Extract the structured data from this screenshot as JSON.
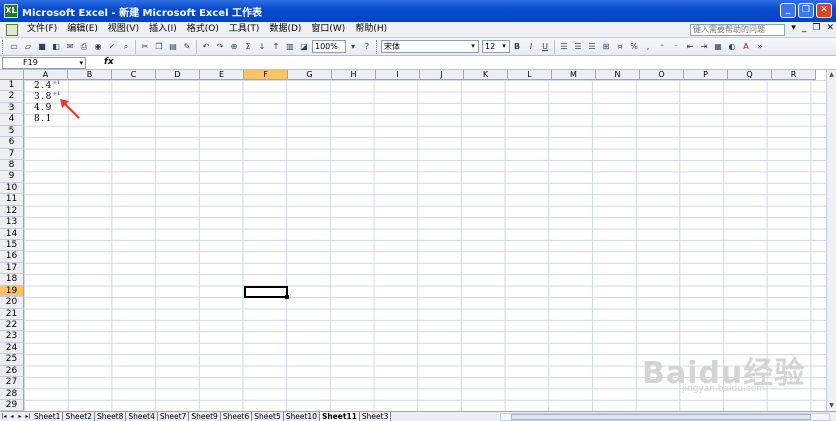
{
  "window": {
    "title": "Microsoft Excel - 新建 Microsoft Excel 工作表",
    "app_icon": "XL"
  },
  "menubar": {
    "items": [
      "文件(F)",
      "编辑(E)",
      "视图(V)",
      "插入(I)",
      "格式(O)",
      "工具(T)",
      "数据(D)",
      "窗口(W)",
      "帮助(H)"
    ],
    "help_placeholder": "键入需要帮助的问题"
  },
  "toolbar": {
    "zoom": "100%",
    "font": "宋体",
    "font_size": "12",
    "bold": "B",
    "italic": "I",
    "underline": "U"
  },
  "formula": {
    "name_box": "F19",
    "fx": "fx"
  },
  "columns": [
    "A",
    "B",
    "C",
    "D",
    "E",
    "F",
    "G",
    "H",
    "I",
    "J",
    "K",
    "L",
    "M",
    "N",
    "O",
    "P",
    "Q",
    "R"
  ],
  "active_column": "F",
  "rows": [
    "1",
    "2",
    "3",
    "4",
    "5",
    "6",
    "7",
    "8",
    "9",
    "10",
    "11",
    "12",
    "13",
    "14",
    "15",
    "16",
    "17",
    "18",
    "19",
    "20",
    "21",
    "22",
    "23",
    "24",
    "25",
    "26",
    "27",
    "28",
    "29"
  ],
  "active_row": "19",
  "cells": [
    {
      "row": 1,
      "col": "A",
      "value": "2.4",
      "sup": "+1"
    },
    {
      "row": 2,
      "col": "A",
      "value": "3.8",
      "sup": "+1"
    },
    {
      "row": 3,
      "col": "A",
      "value": "4.9",
      "sup": ""
    },
    {
      "row": 4,
      "col": "A",
      "value": "8.1",
      "sup": ""
    }
  ],
  "sheets": [
    "Sheet1",
    "Sheet2",
    "Sheet8",
    "Sheet4",
    "Sheet7",
    "Sheet9",
    "Sheet6",
    "Sheet5",
    "Sheet10",
    "Sheet11",
    "Sheet3"
  ],
  "active_sheet": "Sheet11",
  "colors": {
    "titlebar": "#0543c4",
    "active_header": "#f9c468",
    "arrow": "#e83a2a"
  },
  "watermark": {
    "brand": "Baidu经验",
    "url": "jingyan.baidu.com"
  }
}
